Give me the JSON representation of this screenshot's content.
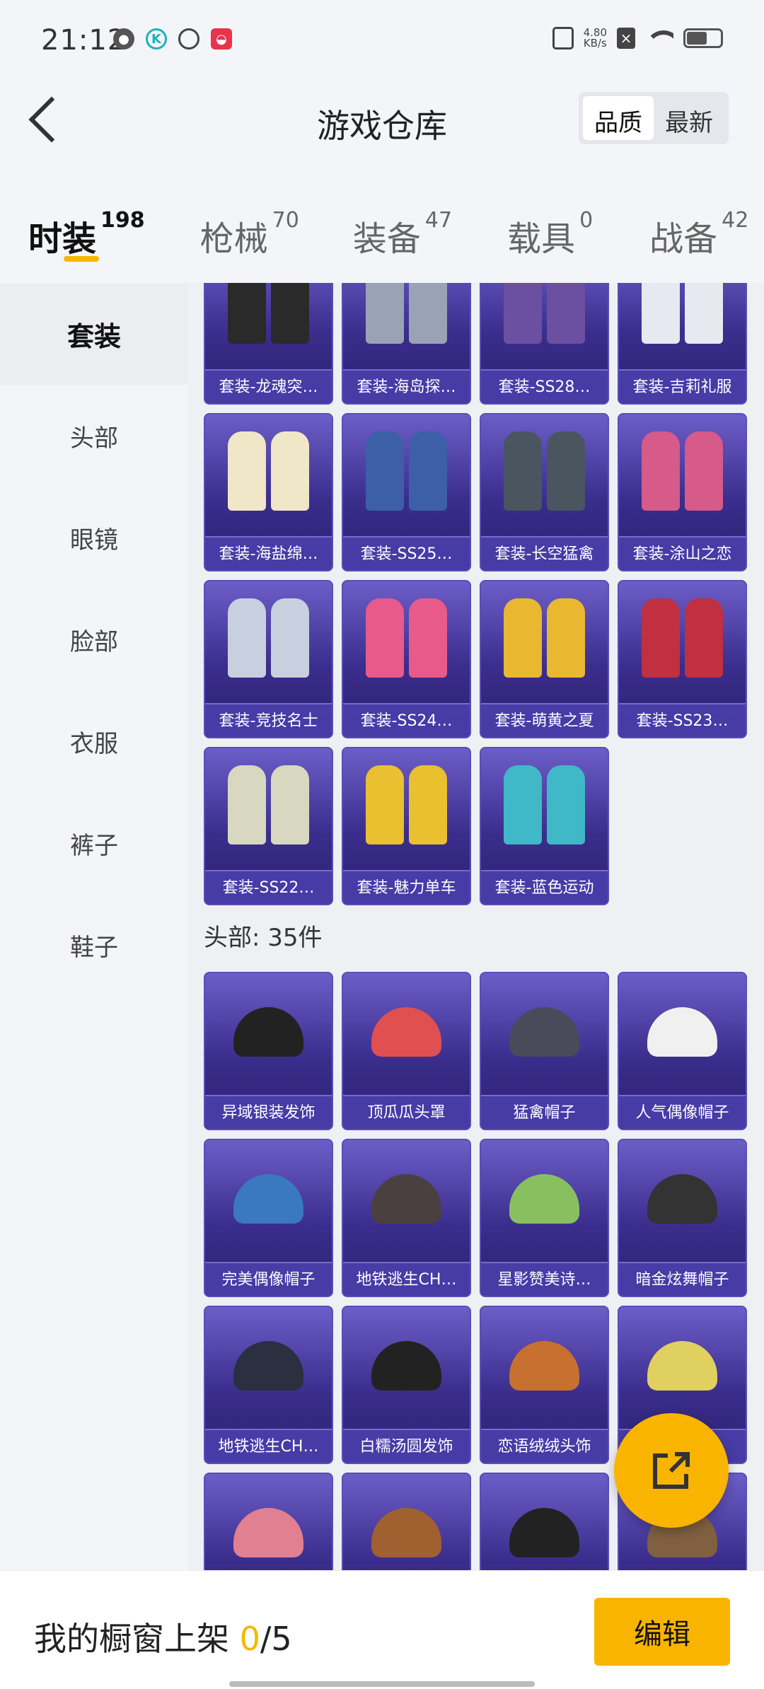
{
  "status_bar": {
    "time": "21:12",
    "net_speed_value": "4.80",
    "net_speed_unit": "KB/s"
  },
  "header": {
    "title": "游戏仓库",
    "sort_options": [
      "品质",
      "最新"
    ],
    "sort_selected": "品质"
  },
  "tabs": [
    {
      "label": "时装",
      "count": "198"
    },
    {
      "label": "枪械",
      "count": "70"
    },
    {
      "label": "装备",
      "count": "47"
    },
    {
      "label": "载具",
      "count": "0"
    },
    {
      "label": "战备",
      "count": "42"
    }
  ],
  "sidebar": {
    "items": [
      "套装",
      "头部",
      "眼镜",
      "脸部",
      "衣服",
      "裤子",
      "鞋子"
    ],
    "active": "套装"
  },
  "suits": [
    "套装-龙魂突…",
    "套装-海岛探…",
    "套装-SS28…",
    "套装-吉莉礼服",
    "套装-海盐绵…",
    "套装-SS25…",
    "套装-长空猛禽",
    "套装-涂山之恋",
    "套装-竞技名士",
    "套装-SS24…",
    "套装-萌黄之夏",
    "套装-SS23…",
    "套装-SS22…",
    "套装-魅力单车",
    "套装-蓝色运动"
  ],
  "head_section": {
    "title": "头部: 35件"
  },
  "head_items": [
    "异域银装发饰",
    "顶瓜瓜头罩",
    "猛禽帽子",
    "人气偶像帽子",
    "完美偶像帽子",
    "地铁逃生CH…",
    "星影赞美诗…",
    "暗金炫舞帽子",
    "地铁逃生CH…",
    "白糯汤圆发饰",
    "恋语绒绒头饰",
    "",
    "",
    "",
    "",
    ""
  ],
  "bottom_bar": {
    "prefix": "我的橱窗上架 ",
    "current": "0",
    "suffix": "/5",
    "edit_label": "编辑"
  },
  "colors": {
    "accent": "#f9b400",
    "card_bg": "#3b2d8c"
  }
}
